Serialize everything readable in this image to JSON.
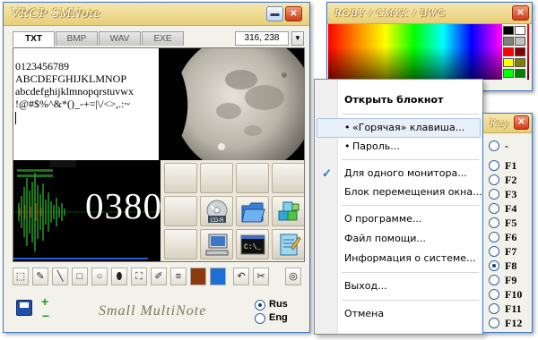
{
  "main_window": {
    "title": "VRCP SMNote",
    "minimize_glyph": "▬",
    "close_glyph": "✕",
    "tabs": [
      "TXT",
      "BMP",
      "WAV",
      "EXE"
    ],
    "active_tab": "TXT",
    "coords": "316, 238",
    "dropdown_glyph": "▼",
    "text_lines": [
      "0123456789",
      "ABCDEFGHIJKLMNOP",
      "abcdefghijklmnopqrstuvwx",
      "!@#$%^&*()_-+=|\\/<>,.:~"
    ],
    "counter": "0380",
    "signature": "Small MultiNote",
    "lang_options": [
      "Rus",
      "Eng"
    ],
    "selected_lang": "Rus",
    "grid_icons": [
      "cd-r-icon",
      "folder-icon",
      "puzzle-icon",
      "computer-icon",
      "console-icon",
      "notepad-icon"
    ],
    "cd_label": "CD-R",
    "console_label": "C:\\_",
    "toolbar_icons": [
      "select-rect-icon",
      "pen-icon",
      "line-icon",
      "rectangle-icon",
      "ellipse-icon",
      "fill-icon",
      "spray-icon",
      "eyedropper-icon",
      "line-width-icon",
      "color-brown-icon",
      "color-blue-icon",
      "undo-icon",
      "clear-icon",
      "target-icon"
    ],
    "tool_glyphs": {
      "select": "⬚",
      "pen": "✎",
      "line": "╲",
      "rect": "□",
      "ellipse": "○",
      "fill": "⬮",
      "spray": "⛶",
      "eyedrop": "✐",
      "width": "≡",
      "undo": "↶",
      "clear": "✂",
      "target": "◎"
    },
    "colors": {
      "brown": "#8b3a0e",
      "blue": "#1c6fd6"
    },
    "save_glyph": "💾",
    "plus_glyph": "+",
    "minus_glyph": "−"
  },
  "palette_window": {
    "title": "RGBY / CMYK / BWG",
    "close_glyph": "✕",
    "swatch_colors": [
      "#000000",
      "#ffffff",
      "#7f7f7f",
      "#c0c0c0",
      "#ff0000",
      "#800000",
      "#ffff00",
      "#808000",
      "#00ff00",
      "#008000"
    ]
  },
  "context_menu": {
    "header": "Открыть блокнот",
    "items": [
      {
        "label": "«Горячая» клавиша...",
        "bullet": "•"
      },
      {
        "label": "Пароль...",
        "bullet": "•"
      },
      {
        "label": "Для одного монитора...",
        "checked": true
      },
      {
        "label": "Блок перемещения окна..."
      },
      {
        "label": "О программе..."
      },
      {
        "label": "Файл помощи..."
      },
      {
        "label": "Информация о системе..."
      },
      {
        "label": "Выход..."
      },
      {
        "label": "Отмена"
      }
    ],
    "check_glyph": "✓"
  },
  "key_window": {
    "title": "Key",
    "close_glyph": "✕",
    "options": [
      "-",
      "F1",
      "F2",
      "F3",
      "F4",
      "F5",
      "F6",
      "F7",
      "F8",
      "F9",
      "F10",
      "F11",
      "F12"
    ],
    "selected": "F8"
  }
}
